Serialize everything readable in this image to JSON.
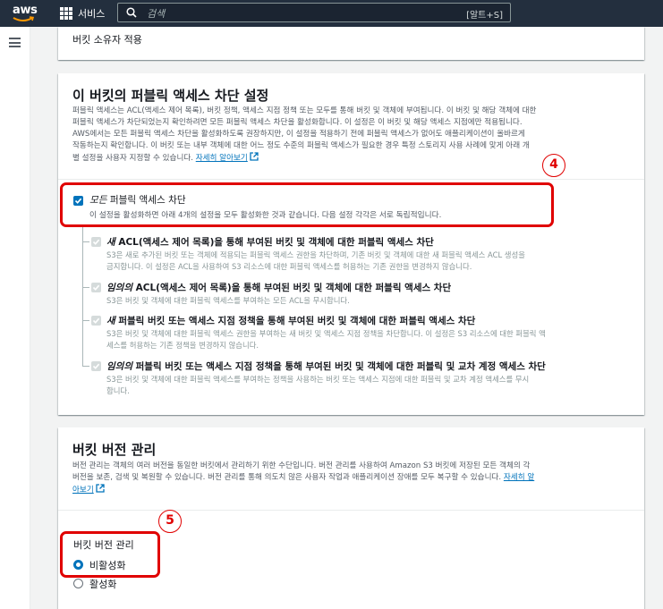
{
  "topnav": {
    "logo": "aws",
    "services_label": "서비스",
    "search_placeholder": "검색",
    "search_shortcut": "[알트+S]"
  },
  "object_ownership": {
    "value": "버킷 소유자 적용"
  },
  "public_access": {
    "title": "이 버킷의 퍼블릭 액세스 차단 설정",
    "description_lines": [
      "퍼블릭 액세스는 ACL(액세스 제어 목록), 버킷 정책, 액세스 지점 정책 또는 모두를 통해 버킷 및 객체에 부여됩니다. 이 버킷 및 해당 객체에 대한",
      "퍼블릭 액세스가 차단되었는지 확인하려면 모든 퍼블릭 액세스 차단을 활성화합니다. 이 설정은 이 버킷 및 해당 액세스 지점에만 적용됩니다.",
      "AWS에서는 모든 퍼블릭 액세스 차단을 활성화하도록 권장하지만, 이 설정을 적용하기 전에 퍼블릭 액세스가 없어도 애플리케이션이 올바르게",
      "작동하는지 확인합니다. 이 버킷 또는 내부 객체에 대한 어느 정도 수준의 퍼블릭 액세스가 필요한 경우 특정 스토리지 사용 사례에 맞게 아래 개",
      "별 설정을 사용자 지정할 수 있습니다."
    ],
    "learn_more": "자세히 알아보기",
    "block_all": {
      "label_italic": "모든",
      "label_rest": " 퍼블릭 액세스 차단",
      "description": "이 설정을 활성화하면 아래 4개의 설정을 모두 활성화한 것과 같습니다. 다음 설정 각각은 서로 독립적입니다.",
      "checked": true
    },
    "sub_settings": [
      {
        "label_italic": "새",
        "label_rest": " ACL(액세스 제어 목록)을 통해 부여된 버킷 및 객체에 대한 퍼블릭 액세스 차단",
        "description_lines": [
          "S3은 새로 추가된 버킷 또는 객체에 적용되는 퍼블릭 액세스 권한을 차단하며, 기존 버킷 및 객체에 대한 새 퍼블릭 액세스 ACL 생성을",
          "금지합니다. 이 설정은 ACL을 사용하여 S3 리소스에 대한 퍼블릭 액세스를 허용하는 기존 권한을 변경하지 않습니다."
        ]
      },
      {
        "label_italic": "임의의",
        "label_rest": " ACL(액세스 제어 목록)을 통해 부여된 버킷 및 객체에 대한 퍼블릭 액세스 차단",
        "description_lines": [
          "S3은 버킷 및 객체에 대한 퍼블릭 액세스를 부여하는 모든 ACL을 무시합니다."
        ]
      },
      {
        "label_italic": "새",
        "label_rest": " 퍼블릭 버킷 또는 액세스 지점 정책을 통해 부여된 버킷 및 객체에 대한 퍼블릭 액세스 차단",
        "description_lines": [
          "S3은 버킷 및 객체에 대한 퍼블릭 액세스 권한을 부여하는 새 버킷 및 액세스 지점 정책을 차단합니다. 이 설정은 S3 리소스에 대한 퍼블릭 액",
          "세스를 허용하는 기존 정책을 변경하지 않습니다."
        ]
      },
      {
        "label_italic": "임의의",
        "label_rest": " 퍼블릭 버킷 또는 액세스 지점 정책을 통해 부여된 버킷 및 객체에 대한 퍼블릭 및 교차 계정 액세스 차단",
        "description_lines": [
          "S3은 버킷 및 객체에 대한 퍼블릭 액세스를 부여하는 정책을 사용하는 버킷 또는 액세스 지점에 대한 퍼블릭 및 교차 계정 액세스를 무시",
          "합니다."
        ]
      }
    ]
  },
  "versioning": {
    "title": "버킷 버전 관리",
    "description_lines": [
      "버전 관리는 객체의 여러 버전을 동일한 버킷에서 관리하기 위한 수단입니다. 버전 관리를 사용하여 Amazon S3 버킷에 저장된 모든 객체의 각",
      "버전을 보존, 검색 및 복원할 수 있습니다. 버전 관리를 통해 의도치 않은 사용자 작업과 애플리케이션 장애를 모두 복구할 수 있습니다."
    ],
    "learn_more_line1": "자세히 알",
    "learn_more_line2": "아보기",
    "field_label": "버킷 버전 관리",
    "options": [
      "비활성화",
      "활성화"
    ],
    "selected": "비활성화"
  },
  "annotations": {
    "badge_4": "4",
    "badge_5": "5",
    "color": "#e00000"
  },
  "colors": {
    "nav_bg": "#232f3e",
    "link": "#0073bb",
    "checkbox_on": "#0073bb",
    "checkbox_disabled": "#d5dbdb"
  }
}
